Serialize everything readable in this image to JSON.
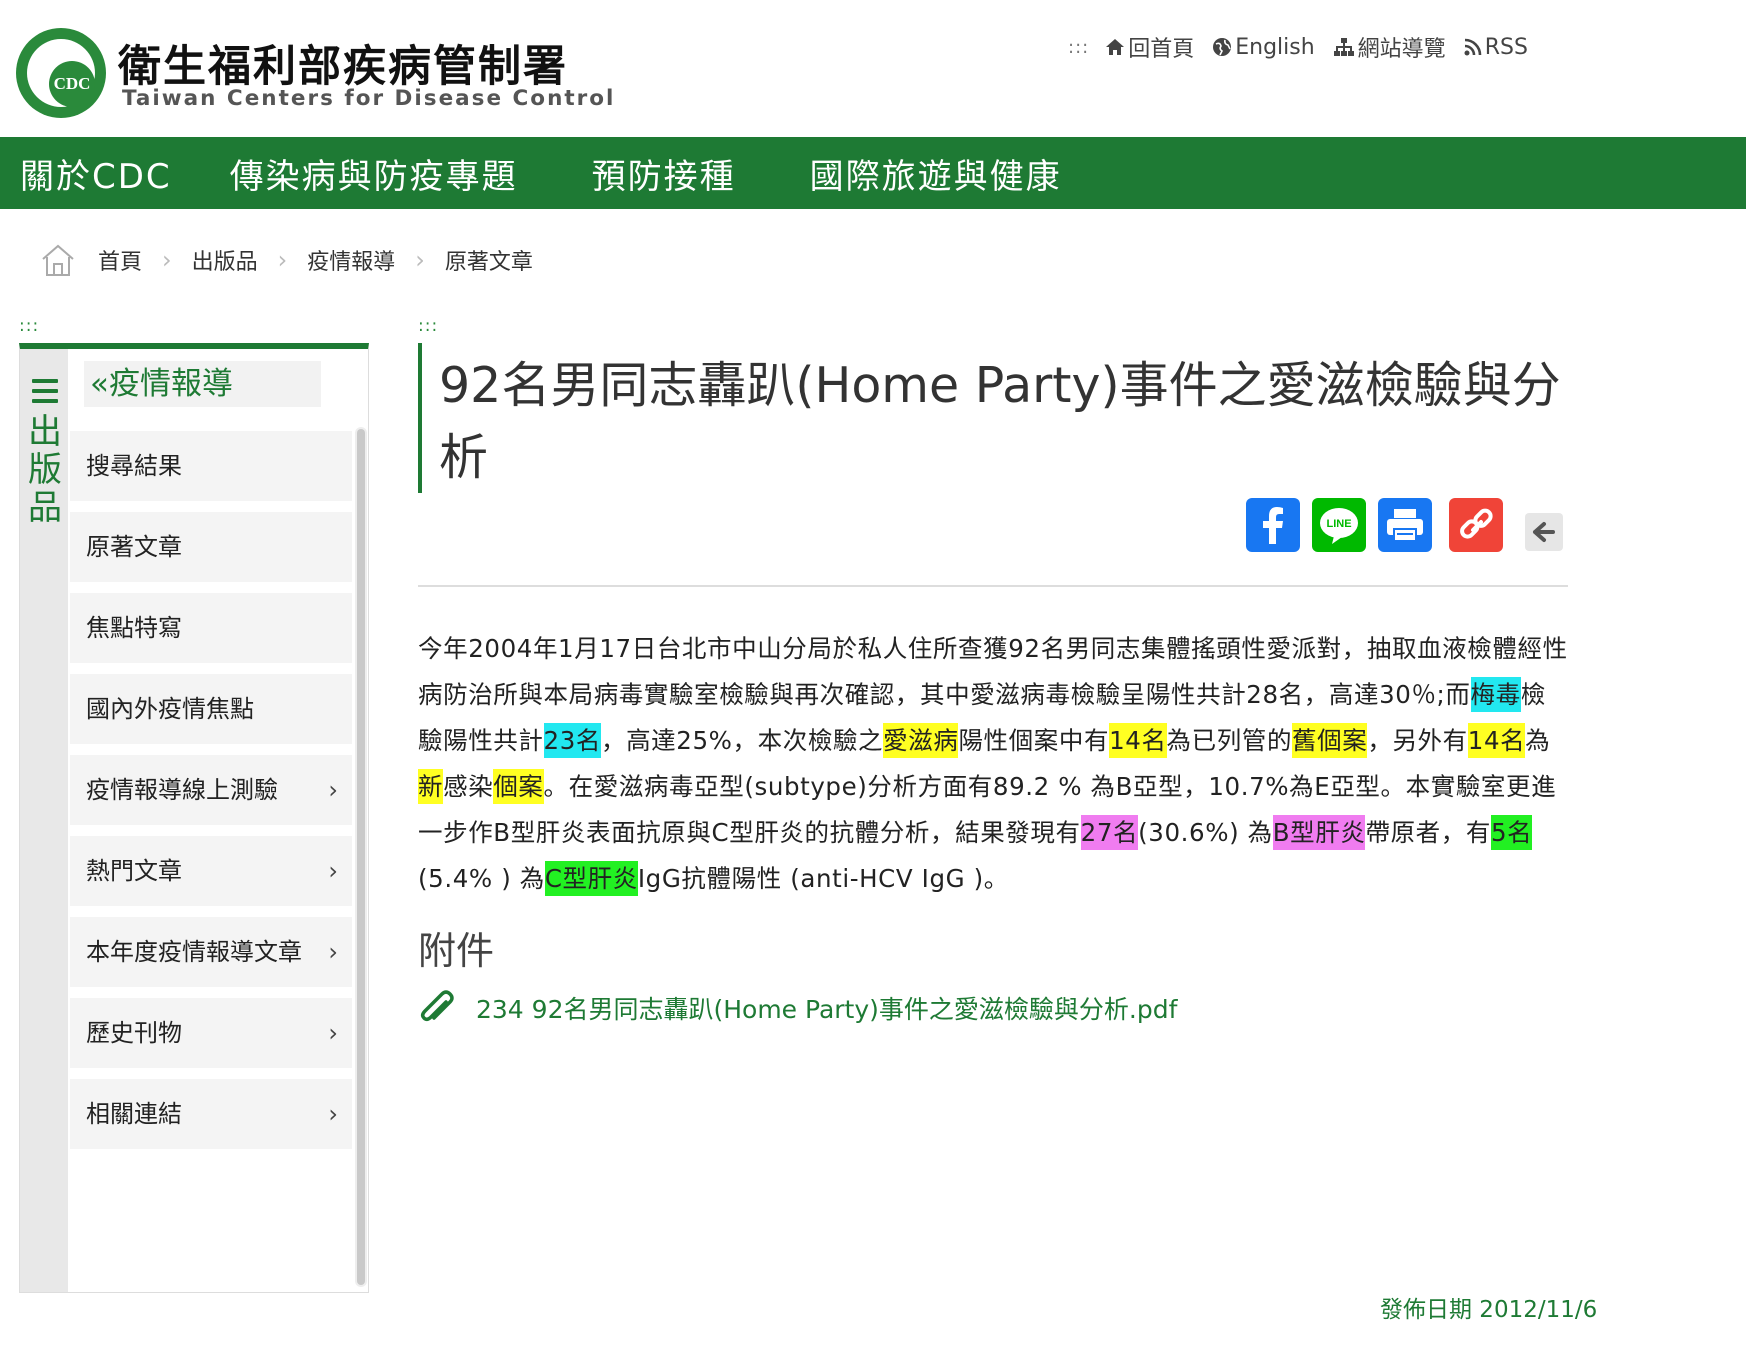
{
  "header": {
    "site_title": "衛生福利部疾病管制署",
    "site_subtitle": "Taiwan Centers for Disease Control",
    "logo_text": "CDC",
    "accesskey": ":::",
    "links": [
      {
        "label": "回首頁",
        "icon": "home-icon"
      },
      {
        "label": "English",
        "icon": "globe-icon"
      },
      {
        "label": "網站導覽",
        "icon": "sitemap-icon"
      },
      {
        "label": "RSS",
        "icon": "rss-icon"
      }
    ]
  },
  "nav": [
    "關於CDC",
    "傳染病與防疫專題",
    "預防接種",
    "國際旅遊與健康"
  ],
  "breadcrumb": [
    "首頁",
    "出版品",
    "疫情報導",
    "原著文章"
  ],
  "sidebar": {
    "accesskey": ":::",
    "rail_label": "出版品",
    "heading": "«疫情報導",
    "items": [
      {
        "label": "搜尋結果",
        "arrow": ""
      },
      {
        "label": "原著文章",
        "arrow": ""
      },
      {
        "label": "焦點特寫",
        "arrow": ""
      },
      {
        "label": "國內外疫情焦點",
        "arrow": ""
      },
      {
        "label": "疫情報導線上測驗",
        "arrow": "›"
      },
      {
        "label": "熱門文章",
        "arrow": "›"
      },
      {
        "label": "本年度疫情報導文章",
        "arrow": "›"
      },
      {
        "label": "歷史刊物",
        "arrow": "›"
      },
      {
        "label": "相關連結",
        "arrow": "›"
      }
    ]
  },
  "content": {
    "accesskey": ":::",
    "title": "92名男同志轟趴(Home Party)事件之愛滋檢驗與分析",
    "share": [
      {
        "name": "facebook-share-button",
        "icon": "facebook-icon",
        "color": "#1877f2"
      },
      {
        "name": "line-share-button",
        "icon": "line-icon",
        "color": "#00b900"
      },
      {
        "name": "print-button",
        "icon": "print-icon",
        "color": "#1877f2"
      },
      {
        "name": "copy-link-button",
        "icon": "link-icon",
        "color": "#f04438"
      }
    ],
    "back_icon": "arrow-left-icon",
    "body": [
      {
        "t": "今年2004年1月17日台北市中山分局於私人住所查獲92名男同志集體搖頭性愛派對，抽取血液檢體經性病防治所與本局病毒實驗室檢驗與再次確認，其中愛滋病毒檢驗呈陽性共計28名，高達30％;而"
      },
      {
        "t": "梅毒",
        "hl": "#22e8f0"
      },
      {
        "t": "檢驗陽性共計"
      },
      {
        "t": "23名",
        "hl": "#22e8f0"
      },
      {
        "t": "，高達25%，本次檢驗之"
      },
      {
        "t": "愛滋病",
        "hl": "#ffff22"
      },
      {
        "t": "陽性個案中有"
      },
      {
        "t": "14名",
        "hl": "#ffff22"
      },
      {
        "t": "為已列管的"
      },
      {
        "t": "舊個案",
        "hl": "#ffff22"
      },
      {
        "t": "，另外有"
      },
      {
        "t": "14名",
        "hl": "#ffff22"
      },
      {
        "t": "為"
      },
      {
        "t": "新",
        "hl": "#ffff22"
      },
      {
        "t": "感染"
      },
      {
        "t": "個案",
        "hl": "#ffff22"
      },
      {
        "t": "。在愛滋病毒亞型(subtype)分析方面有89.2 % 為B亞型，10.7%為E亞型。本實驗室更進一步作B型肝炎表面抗原與C型肝炎的抗體分析，結果發現有"
      },
      {
        "t": "27名",
        "hl": "#f07cf0"
      },
      {
        "t": "(30.6%) 為"
      },
      {
        "t": "B型肝炎",
        "hl": "#f07cf0"
      },
      {
        "t": "帶原者，有"
      },
      {
        "t": "5名",
        "hl": "#22f022"
      },
      {
        "t": " (5.4% ) 為"
      },
      {
        "t": "C型肝炎",
        "hl": "#22f022"
      },
      {
        "t": "IgG抗體陽性 (anti-HCV IgG )。"
      }
    ],
    "attachments_heading": "附件",
    "attachment_label": "234 92名男同志轟趴(Home Party)事件之愛滋檢驗與分析.pdf",
    "publish_date": "發佈日期 2012/11/6"
  }
}
